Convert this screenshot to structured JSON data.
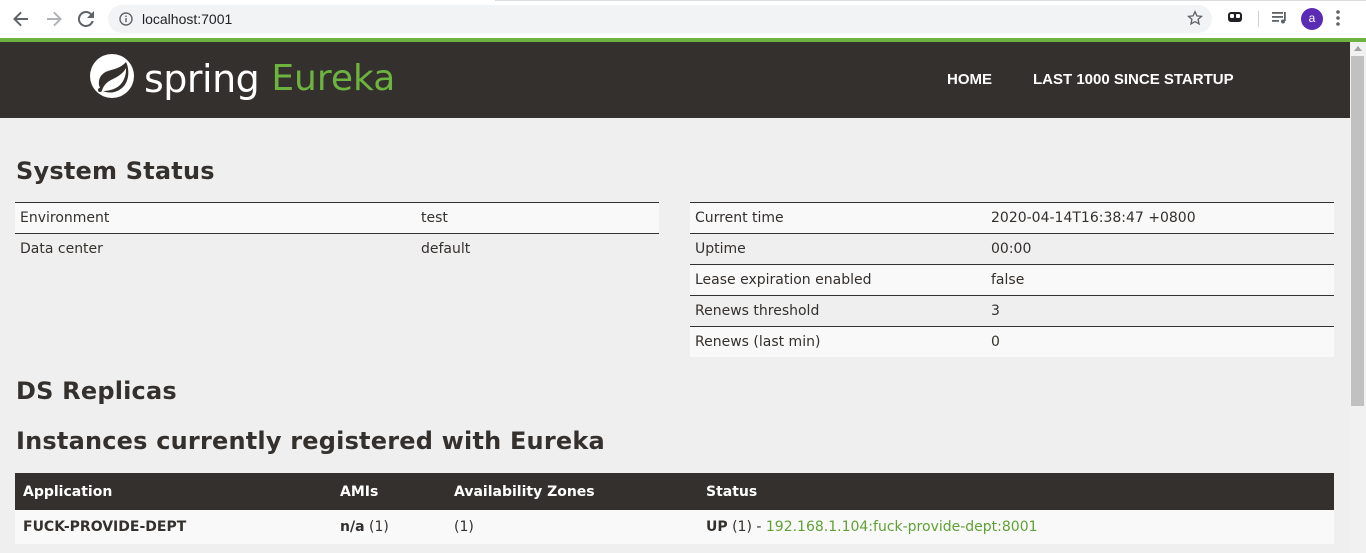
{
  "browser": {
    "url": "localhost:7001",
    "avatar_letter": "a",
    "icons": [
      "back-icon",
      "forward-icon",
      "reload-icon",
      "info-icon",
      "star-icon",
      "extension-icon",
      "media-queue-icon",
      "menu-icon"
    ]
  },
  "navbar": {
    "brand_spring": "spring",
    "brand_eureka": "Eureka",
    "home_label": "HOME",
    "last_label": "LAST 1000 SINCE STARTUP"
  },
  "system_status": {
    "title": "System Status",
    "left": [
      {
        "label": "Environment",
        "value": "test"
      },
      {
        "label": "Data center",
        "value": "default"
      }
    ],
    "right": [
      {
        "label": "Current time",
        "value": "2020-04-14T16:38:47 +0800"
      },
      {
        "label": "Uptime",
        "value": "00:00"
      },
      {
        "label": "Lease expiration enabled",
        "value": "false"
      },
      {
        "label": "Renews threshold",
        "value": "3"
      },
      {
        "label": "Renews (last min)",
        "value": "0"
      }
    ]
  },
  "ds_replicas": {
    "title": "DS Replicas"
  },
  "instances": {
    "title": "Instances currently registered with Eureka",
    "headers": [
      "Application",
      "AMIs",
      "Availability Zones",
      "Status"
    ],
    "rows": [
      {
        "application": "FUCK-PROVIDE-DEPT",
        "amis_bold": "n/a",
        "amis_count": " (1)",
        "zones": "(1)",
        "status_bold": "UP",
        "status_count": " (1) - ",
        "status_link": "192.168.1.104:fuck-provide-dept:8001"
      }
    ]
  },
  "colors": {
    "navbar_bg": "#34302d",
    "accent_green": "#6db33f",
    "page_bg": "#efefef"
  }
}
